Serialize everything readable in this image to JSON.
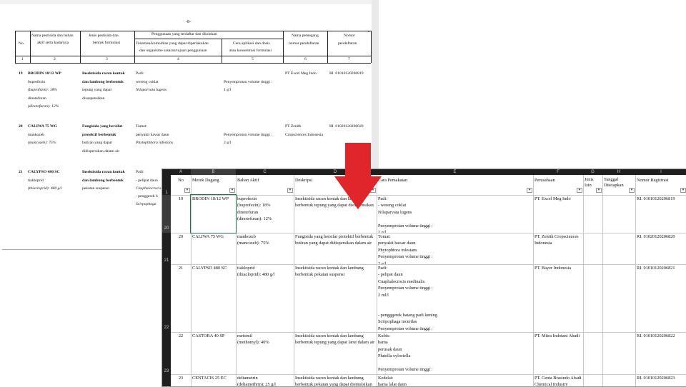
{
  "document": {
    "page_number": "-8-",
    "corner_mark": ".",
    "headers": {
      "no": "No.",
      "name": [
        "Nama pestisida dan bahan",
        "aktif serta kadarnya"
      ],
      "type": [
        "Jenis pestisida dan",
        "bentuk formulasi"
      ],
      "usage": "Penggunaan yang terdaftar dan diizinkan",
      "crop": [
        "Tanaman/komoditas yang dapat diperlakukan",
        "dan organisme sasaran/tujuan penggunaan"
      ],
      "method": [
        "Cara aplikasi dan dosis",
        "atau konsentrasi formulasi"
      ],
      "holder": [
        "Nama pemegang",
        "nomor pendaftaran"
      ],
      "regnum": [
        "Nomor",
        "pendaftaran"
      ],
      "col_numbers": [
        "1",
        "2",
        "3",
        "4",
        "5",
        "6",
        "7"
      ]
    },
    "rows": [
      {
        "no": "19",
        "name": "BRODIN 18/12 WP",
        "ingredients": [
          "buprofezin",
          "(buprofezin): 18%",
          "dinotefuran",
          "(dinotefuran): 12%"
        ],
        "type": [
          "Insektisida racun kontak",
          "dan lambung berbentuk",
          "tepung yang dapat",
          "disuspensikan"
        ],
        "crop": [
          "Padi:",
          "wereng coklat",
          "Nilaparvata lugens"
        ],
        "method": [
          "Penyemprotan volume tinggi :",
          "1 g/l"
        ],
        "holder": "PT Excel Meg Indo",
        "regnum": "RI. 01010120206819"
      },
      {
        "no": "20",
        "name": "CALIWA 75 WG",
        "ingredients": [
          "mankozeb",
          "(mancozeb): 75%"
        ],
        "type": [
          "Fungisida yang bersifat",
          "protektif berbentuk",
          "butiran yang dapat",
          "didispersikan dalam air"
        ],
        "crop": [
          "Tomat:",
          "penyakit hawar daun",
          "Phytophthora infestans"
        ],
        "method": [
          "Penyemprotan volume tinggi :",
          "2 g/l"
        ],
        "holder": [
          "PT Zenith",
          "Cropsciences Indonesia"
        ],
        "regnum": "RI. 01020120206820"
      },
      {
        "no": "21",
        "name": "CALYPSO 480 SC",
        "ingredients": [
          "tiakloprid",
          "(thiacloprid): 480 g/l"
        ],
        "type": [
          "Insektisida racun kontak",
          "dan lambung berbentuk",
          "pekatan suspensi"
        ],
        "crop": [
          "Padi:",
          "- pelipat daun",
          "Cnaphalocrocis",
          "- penggerek b",
          "Scirpophaga"
        ]
      }
    ]
  },
  "spreadsheet": {
    "column_letters": [
      "A",
      "B",
      "C",
      "D",
      "E",
      "F",
      "G",
      "H",
      "I"
    ],
    "headers": {
      "no": "No",
      "merek": "Merek Dagang",
      "bahan": "Bahan Aktif",
      "deskripsi": "Deskripsi",
      "cara": "Cara Pemakaian",
      "perusahaan": "Perusahaan",
      "jenis_izin": [
        "Jenis",
        "Izin"
      ],
      "tanggal": [
        "Tanggal",
        "Ditetapkan"
      ],
      "nomor": "Nomor Registrasi"
    },
    "row_numbers": [
      "1",
      "20",
      "21",
      "22",
      "23"
    ],
    "rows": [
      {
        "no": "19",
        "merek": "BRODIN 18/12 WP",
        "bahan": "buprofezin\n(buprofezin): 18%\ndinotefuran\n(dinotefuran): 12%",
        "deskripsi": "Insektisida racun kontak dan lambung\nberbentuk tepung yang dapat disuspensikan",
        "cara": "Padi:\n- wereng coklat\nNilaparvata lugens\n\nPenyemprotan volume tinggi :\n1 g/l",
        "perusahaan": "PT. Excel Meg Indo",
        "nomor": "RI. 01010120206819"
      },
      {
        "no": "20",
        "merek": "CALIWA 75 WG",
        "bahan": "mankozeb\n(mancozeb): 75%",
        "deskripsi": "Fungisida yang bersifat protektif berbentuk\nbutiran yang dapat didispersikan dalam air",
        "cara": "Tomat:\npenyakit hawar daun\nPhytophtora infestans\nPenyemprotan volume tinggi :\n2 g/l",
        "perusahaan": "PT. Zenith Cropsciences\nIndonesia",
        "nomor": "RI. 01020120206820"
      },
      {
        "no": "21",
        "merek": "CALYPSO 480 SC",
        "bahan": "tiakloprid\n(thiacloprid): 480 g/l",
        "deskripsi": "Insektisida racun kontak dan lambung\nberbentuk pekatan suspensi",
        "cara": "Padi:\n- pelipat daun\nCnaphalocrocis medinalis\nPenyemprotan volume tinggi :\n2 ml/l\n\n\n- pengggerek batang padi kuning\nScirpophaga incertlas\nPenyemprotan volume tinggi :\n2 ml/l",
        "perusahaan": "PT. Bayer Indonesia",
        "nomor": "RI. 01010120206821"
      },
      {
        "no": "22",
        "merek": "CASTORA 40 SP",
        "bahan": "metomil\n(methomyl): 40%",
        "deskripsi": "Insektisida racun kontak dan lambung\nberbentuk tepung yang dapat larut dalam air",
        "cara": "Kubis:\nhama\nperusak daun\nPlutella xylostella\n\nPenyemprotan volume tinggi :\n2 g/l",
        "perusahaan": "PT. Mitra Indotani Abadi",
        "nomor": "RI. 01010120206822"
      },
      {
        "no": "23",
        "merek": "CENTACIS 25 EC",
        "bahan": "deltametrin\n(deltamethrin): 25 g/l",
        "deskripsi": "Insektisida racun kontak dan lambung\nberbentuk pekatan yang dapat diemulsikan",
        "cara": "Kedelai:\nhama lalat daun",
        "perusahaan": "PT. Centa Brasindo Abadi\nChemical Industry",
        "nomor": "RI. 01010120206823"
      }
    ],
    "filter_glyph": "▾"
  },
  "arrow": {
    "color": "#e0262b"
  }
}
